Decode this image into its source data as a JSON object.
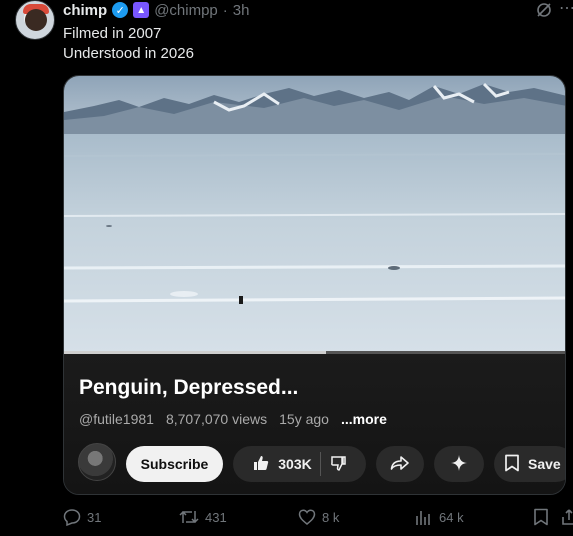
{
  "post": {
    "author_name": "chimp",
    "handle": "@chimpp",
    "separator": "·",
    "time": "3h",
    "text_line1": "Filmed in 2007",
    "text_line2": "Understood in 2026"
  },
  "video": {
    "title": "Penguin, Depressed...",
    "channel": "@futile1981",
    "views": "8,707,070 views",
    "age": "15y ago",
    "more_label": "...more",
    "progress_fraction": 0.52
  },
  "controls": {
    "subscribe_label": "Subscribe",
    "like_count": "303K",
    "save_label": "Save"
  },
  "actions": {
    "replies": "31",
    "reposts": "431",
    "likes": "8 k",
    "views": "64 k"
  },
  "colors": {
    "verified": "#1d9bf0",
    "affiliate": "#7856ff",
    "muted": "#71767b"
  }
}
